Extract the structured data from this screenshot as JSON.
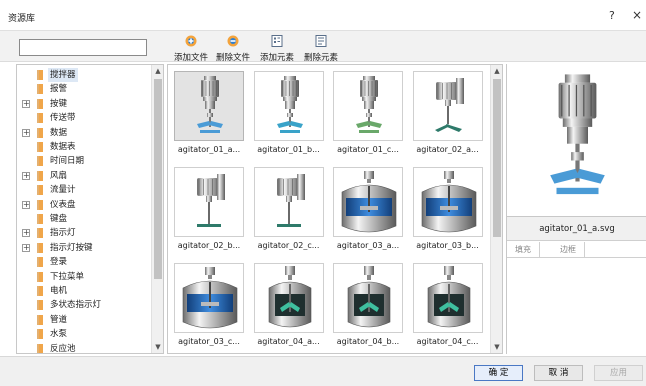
{
  "window": {
    "title": "资源库",
    "help": "?",
    "close": "×"
  },
  "toolbar": {
    "search_value": "",
    "buttons": [
      {
        "label": "添加文件",
        "icon": "add-file-icon"
      },
      {
        "label": "删除文件",
        "icon": "delete-file-icon"
      },
      {
        "label": "添加元素",
        "icon": "add-element-icon"
      },
      {
        "label": "删除元素",
        "icon": "delete-element-icon"
      }
    ]
  },
  "tree": {
    "items": [
      {
        "label": "搅拌器",
        "expandable": false,
        "selected": true
      },
      {
        "label": "报警",
        "expandable": false
      },
      {
        "label": "按键",
        "expandable": true
      },
      {
        "label": "传送带",
        "expandable": false
      },
      {
        "label": "数据",
        "expandable": true
      },
      {
        "label": "数据表",
        "expandable": false
      },
      {
        "label": "时间日期",
        "expandable": false
      },
      {
        "label": "风扇",
        "expandable": true
      },
      {
        "label": "流量计",
        "expandable": false
      },
      {
        "label": "仪表盘",
        "expandable": true
      },
      {
        "label": "键盘",
        "expandable": false
      },
      {
        "label": "指示灯",
        "expandable": true
      },
      {
        "label": "指示灯按键",
        "expandable": true
      },
      {
        "label": "登录",
        "expandable": false
      },
      {
        "label": "下拉菜单",
        "expandable": false
      },
      {
        "label": "电机",
        "expandable": false
      },
      {
        "label": "多状态指示灯",
        "expandable": false
      },
      {
        "label": "管道",
        "expandable": false
      },
      {
        "label": "水泵",
        "expandable": false
      },
      {
        "label": "反应池",
        "expandable": false
      }
    ]
  },
  "grid": {
    "items": [
      {
        "caption": "agitator_01_a...",
        "kind": "motor-a",
        "selected": true
      },
      {
        "caption": "agitator_01_b...",
        "kind": "motor-b"
      },
      {
        "caption": "agitator_01_c...",
        "kind": "motor-c"
      },
      {
        "caption": "agitator_02_a...",
        "kind": "motor2-a"
      },
      {
        "caption": "agitator_02_b...",
        "kind": "motor2-b"
      },
      {
        "caption": "agitator_02_c...",
        "kind": "motor2-c"
      },
      {
        "caption": "agitator_03_a...",
        "kind": "tank-a"
      },
      {
        "caption": "agitator_03_b...",
        "kind": "tank-b"
      },
      {
        "caption": "agitator_03_c...",
        "kind": "tank-c"
      },
      {
        "caption": "agitator_04_a...",
        "kind": "vessel-a"
      },
      {
        "caption": "agitator_04_b...",
        "kind": "vessel-b"
      },
      {
        "caption": "agitator_04_c...",
        "kind": "vessel-c"
      }
    ]
  },
  "preview": {
    "file_name": "agitator_01_a.svg",
    "tabs": [
      "填充",
      "边框"
    ]
  },
  "footer": {
    "ok": "确 定",
    "cancel": "取 消",
    "apply": "应用"
  },
  "colors": {
    "accent": "#4a78c4",
    "folder": "#f0a64a",
    "blade": "#4a9bd6",
    "tank_blue": "#1d63b8"
  }
}
